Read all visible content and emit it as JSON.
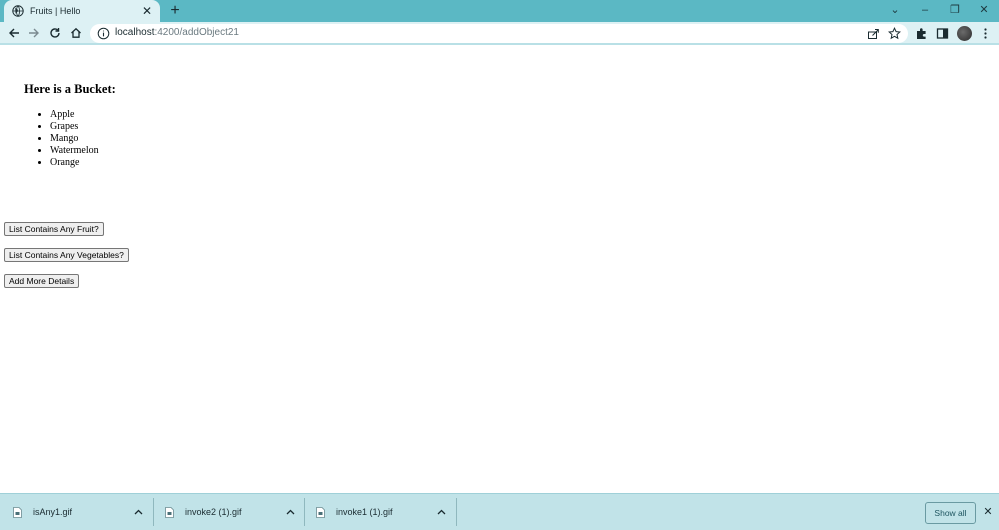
{
  "tab": {
    "title": "Fruits | Hello",
    "close_glyph": "✕",
    "new_tab_glyph": "+"
  },
  "window_controls": {
    "tab_search_glyph": "⌄",
    "minimize_glyph": "–",
    "restore_glyph": "❐",
    "close_glyph": "✕"
  },
  "address_bar": {
    "host": "localhost",
    "path": ":4200/addObject21"
  },
  "page": {
    "heading": "Here is a Bucket:",
    "fruits": [
      "Apple",
      "Grapes",
      "Mango",
      "Watermelon",
      "Orange"
    ],
    "buttons": {
      "contains_fruit": "List Contains Any Fruit?",
      "contains_vegetables": "List Contains Any Vegetables?",
      "add_details": "Add More Details"
    }
  },
  "downloads": {
    "items": [
      {
        "name": "isAny1.gif"
      },
      {
        "name": "invoke2 (1).gif"
      },
      {
        "name": "invoke1 (1).gif"
      }
    ],
    "show_all": "Show all",
    "close_glyph": "✕"
  },
  "colors": {
    "tabstrip": "#5bb8c4",
    "toolbar": "#ddf1f4",
    "shelf": "#c1e3e8"
  }
}
